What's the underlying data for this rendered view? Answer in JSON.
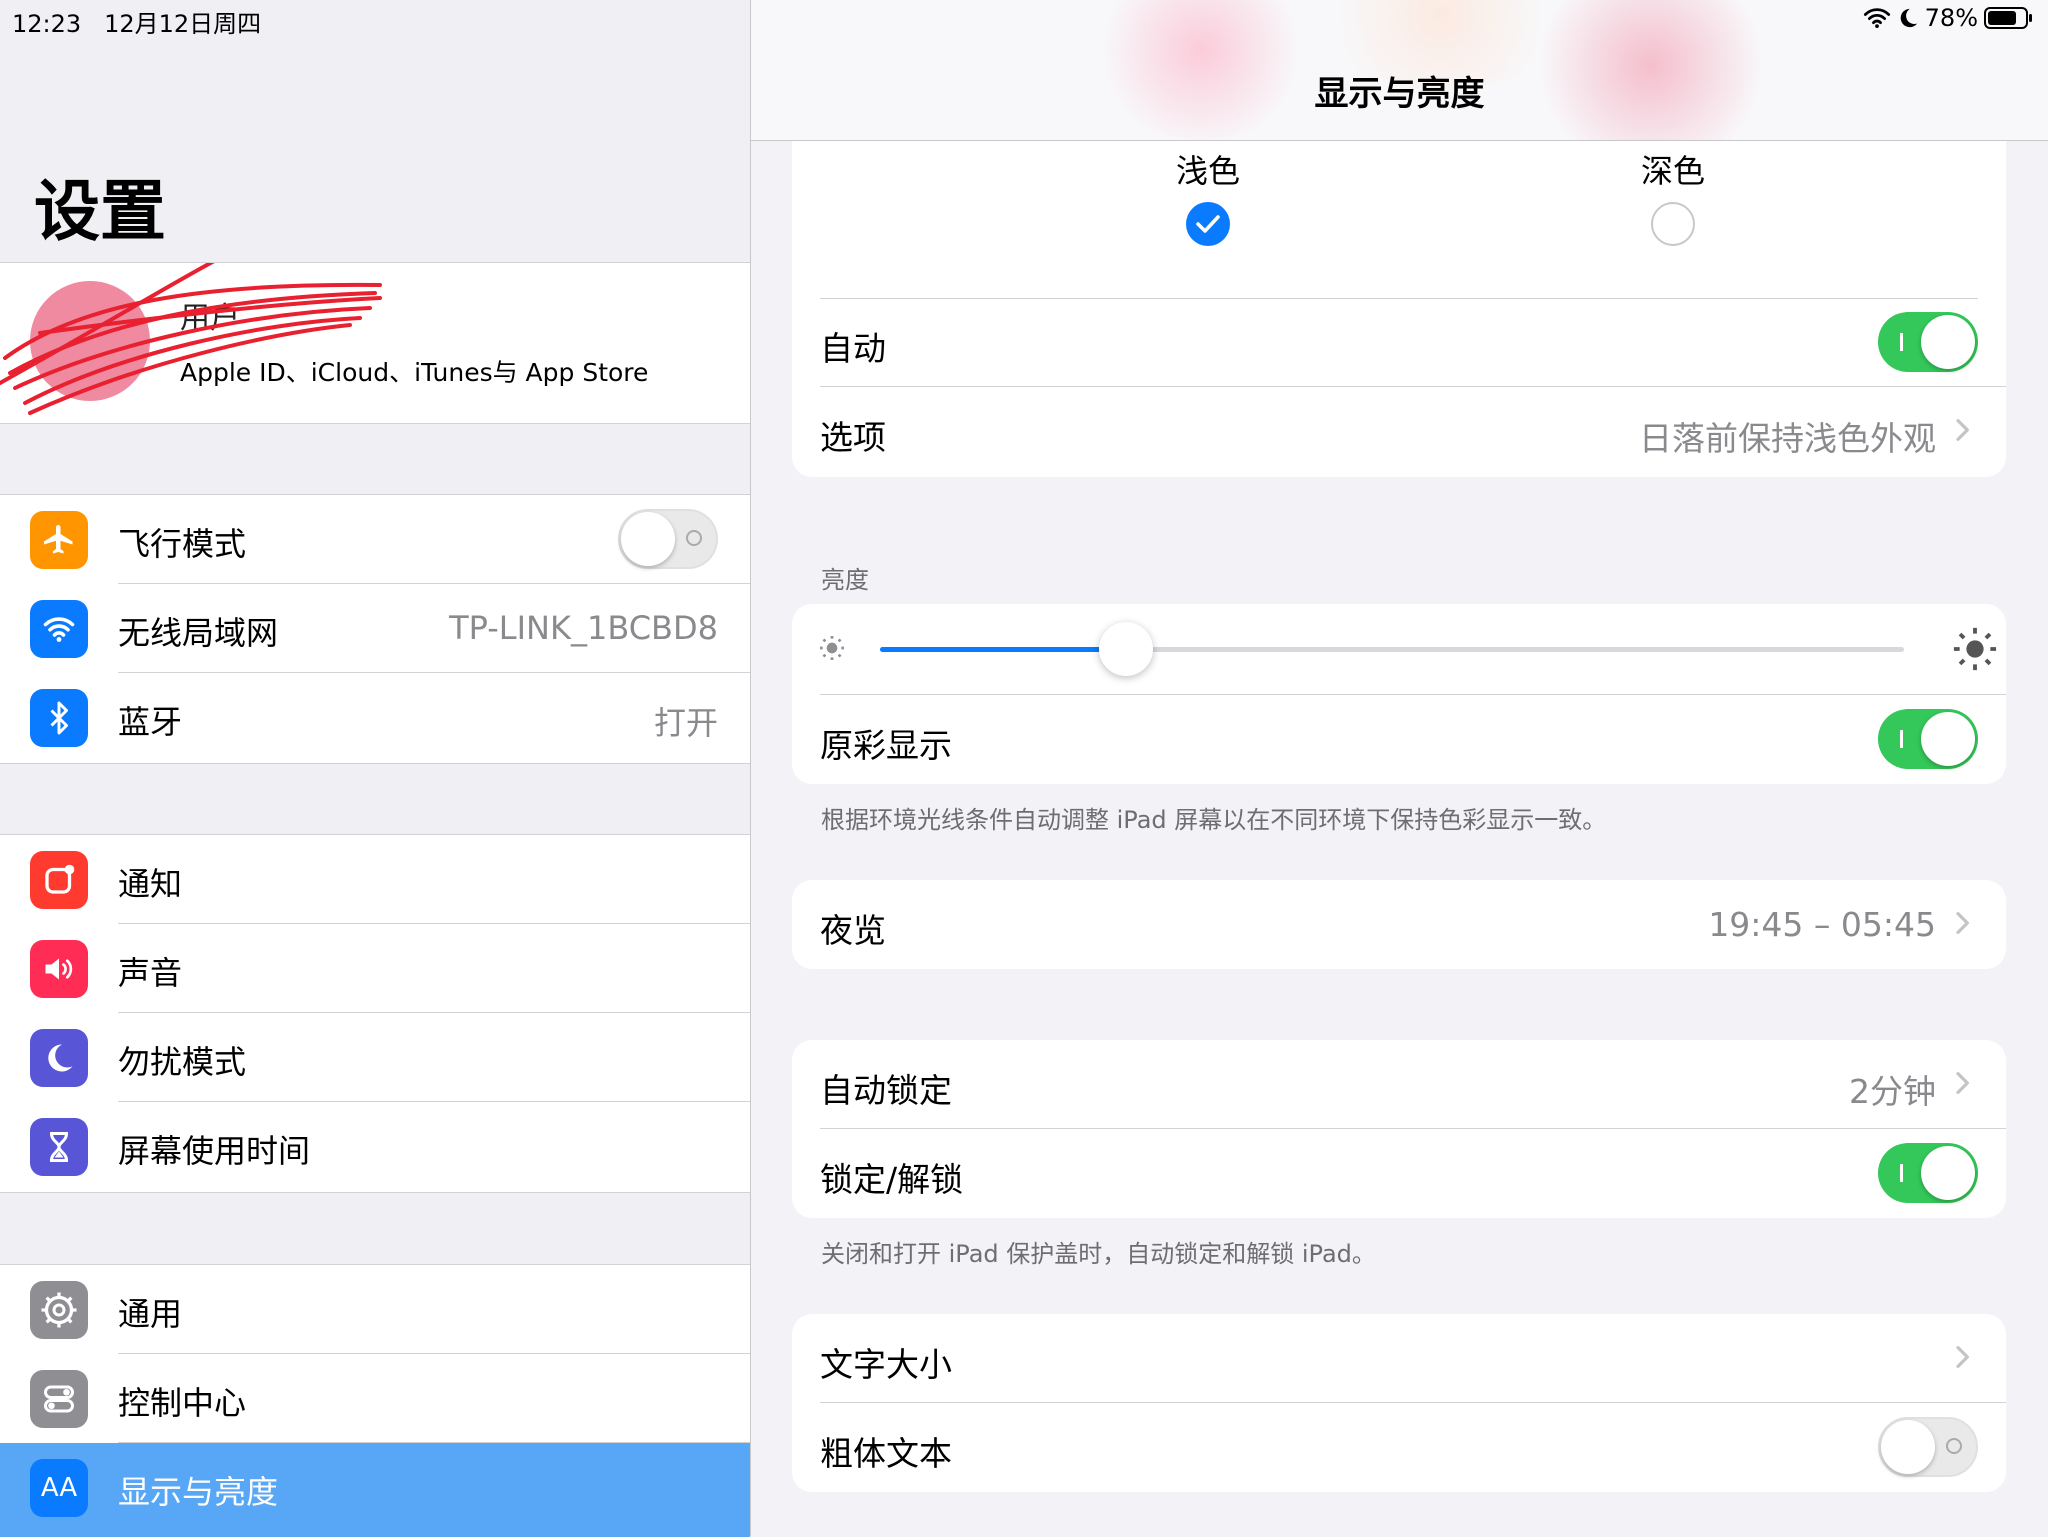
{
  "status": {
    "time": "12:23",
    "date": "12月12日周四",
    "battery": "78%"
  },
  "sidebar": {
    "title": "设置",
    "profile": {
      "name": "用户",
      "subtitle": "Apple ID、iCloud、iTunes与 App Store"
    },
    "groups": [
      [
        {
          "label": "飞行模式",
          "icon": "airplane-icon",
          "color": "#ff9500",
          "toggle": "off"
        },
        {
          "label": "无线局域网",
          "icon": "wifi-icon",
          "color": "#0a7aff",
          "value": "TP-LINK_1BCBD8"
        },
        {
          "label": "蓝牙",
          "icon": "bluetooth-icon",
          "color": "#0a7aff",
          "value": "打开"
        }
      ],
      [
        {
          "label": "通知",
          "icon": "notifications-icon",
          "color": "#ff3b30"
        },
        {
          "label": "声音",
          "icon": "sound-icon",
          "color": "#ff2d55"
        },
        {
          "label": "勿扰模式",
          "icon": "moon-icon",
          "color": "#5856d6"
        },
        {
          "label": "屏幕使用时间",
          "icon": "hourglass-icon",
          "color": "#5856d6"
        }
      ],
      [
        {
          "label": "通用",
          "icon": "gear-icon",
          "color": "#8e8e93"
        },
        {
          "label": "控制中心",
          "icon": "control-center-icon",
          "color": "#8e8e93"
        },
        {
          "label": "显示与亮度",
          "icon": "display-icon",
          "color": "#0a7aff",
          "selected": true,
          "icon_text": "AA"
        }
      ]
    ]
  },
  "detail": {
    "title": "显示与亮度",
    "appearance": {
      "light_label": "浅色",
      "dark_label": "深色",
      "selected": "light",
      "auto_label": "自动",
      "auto_toggle": "on",
      "options_label": "选项",
      "options_value": "日落前保持浅色外观"
    },
    "brightness": {
      "header": "亮度",
      "level": 0.24,
      "true_tone_label": "原彩显示",
      "true_tone_toggle": "on",
      "caption": "根据环境光线条件自动调整 iPad 屏幕以在不同环境下保持色彩显示一致。"
    },
    "night_shift": {
      "label": "夜览",
      "value": "19:45 – 05:45"
    },
    "lock": {
      "auto_lock_label": "自动锁定",
      "auto_lock_value": "2分钟",
      "lock_unlock_label": "锁定/解锁",
      "lock_unlock_toggle": "on",
      "caption": "关闭和打开 iPad 保护盖时，自动锁定和解锁 iPad。"
    },
    "text": {
      "text_size_label": "文字大小",
      "bold_text_label": "粗体文本",
      "bold_toggle": "off"
    }
  },
  "colors": {
    "accent": "#0a7aff",
    "switch_on": "#34c759",
    "selected_row": "#58a6f6"
  }
}
